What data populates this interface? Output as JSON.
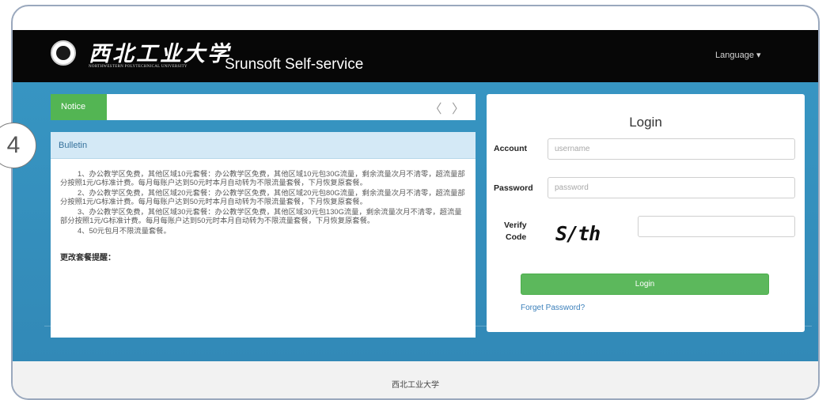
{
  "header": {
    "logo_cn": "西北工业大学",
    "logo_en": "NORTHWESTERN POLYTECHNICAL UNIVERSITY",
    "app_title": "Srunsoft Self-service",
    "language_label": "Language ▾"
  },
  "notice": {
    "tab_label": "Notice",
    "arrows": "〈 〉"
  },
  "bulletin": {
    "title": "Bulletin",
    "items": [
      "1、办公教学区免费，其他区域10元套餐：办公教学区免费，其他区域10元包30G流量，剩余流量次月不清零，超流量部分按照1元/G标准计费。每月每账户达到50元时本月自动转为不限流量套餐，下月恢复原套餐。",
      "2、办公教学区免费，其他区域20元套餐：办公教学区免费，其他区域20元包80G流量，剩余流量次月不清零，超流量部分按照1元/G标准计费。每月每账户达到50元时本月自动转为不限流量套餐，下月恢复原套餐。",
      "3、办公教学区免费，其他区域30元套餐：办公教学区免费，其他区域30元包130G流量，剩余流量次月不清零，超流量部分按照1元/G标准计费。每月每账户达到50元时本月自动转为不限流量套餐，下月恢复原套餐。",
      "4、50元包月不限流量套餐。"
    ],
    "tail": "更改套餐提醒："
  },
  "login": {
    "title": "Login",
    "account_label": "Account",
    "account_placeholder": "username",
    "password_label": "Password",
    "password_placeholder": "password",
    "verify_label_1": "Verify",
    "verify_label_2": "Code",
    "captcha_text": "S/th",
    "button_label": "Login",
    "forgot_label": "Forget Password?"
  },
  "footer": {
    "text": "西北工业大学"
  },
  "step_badge": "4"
}
